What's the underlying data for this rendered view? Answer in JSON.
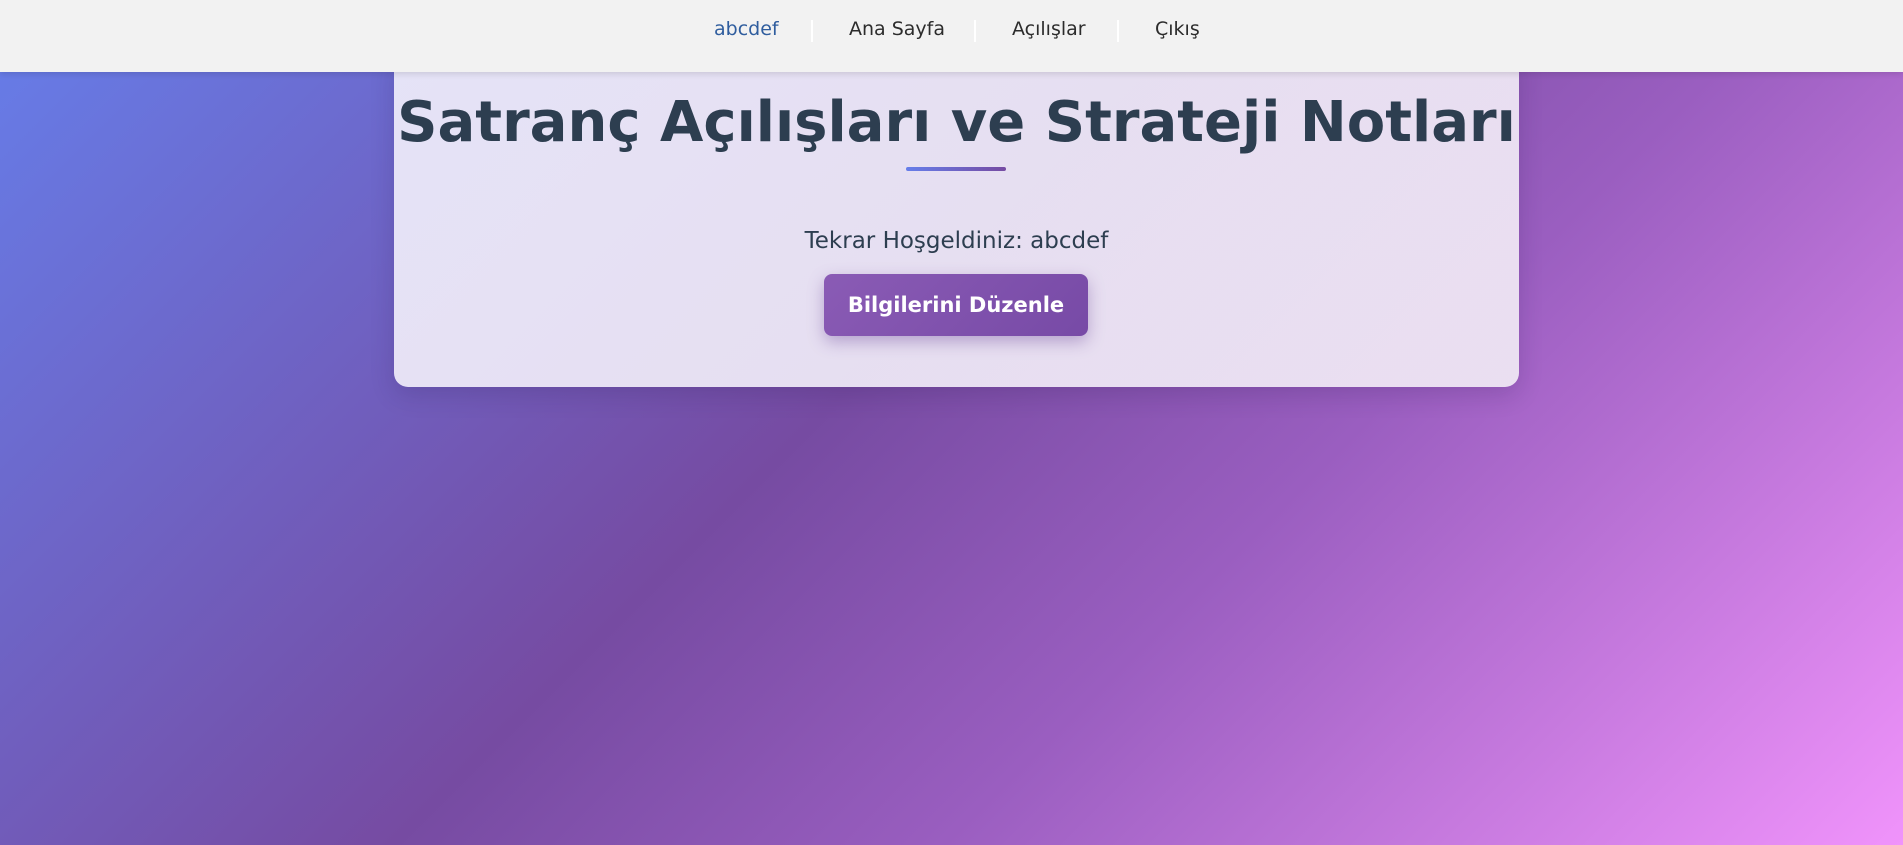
{
  "nav": {
    "user_label": "abcdef",
    "home_label": "Ana Sayfa",
    "openings_label": "Açılışlar",
    "logout_label": "Çıkış"
  },
  "main": {
    "title": "Satranç Açılışları ve Strateji Notları",
    "welcome_text": "Tekrar Hoşgeldiniz: abcdef",
    "edit_button_label": "Bilgilerini Düzenle"
  },
  "colors": {
    "nav_background": "#f2f2f2",
    "user_link": "#2f5d9e",
    "title_text": "#2d3e50",
    "button_background": "#8258b0",
    "gradient_start": "#667eea",
    "gradient_mid": "#764ba2",
    "gradient_end": "#f093fb"
  }
}
